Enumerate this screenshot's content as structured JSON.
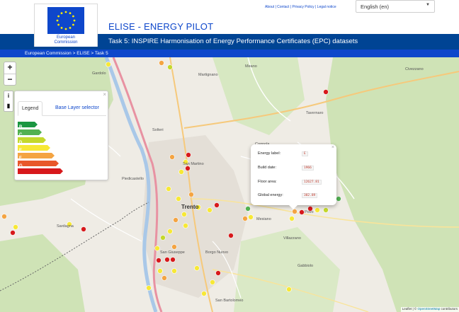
{
  "header": {
    "logo_text_line1": "European",
    "logo_text_line2": "Commission",
    "app_title": "ELISE - ENERGY PILOT",
    "links": [
      "About",
      "Contact",
      "Privacy Policy",
      "Legal notice"
    ],
    "language": "English (en)"
  },
  "subheader": {
    "task_title": "Task 5: INSPIRE Harmonisation of Energy Performance Certificates (EPC) datasets",
    "breadcrumb": [
      "European Commission",
      "ELISE",
      "Task 5"
    ]
  },
  "map": {
    "places": [
      {
        "name": "Trento",
        "big": true
      },
      {
        "name": "Martignano"
      },
      {
        "name": "Civezzano"
      },
      {
        "name": "Meano"
      },
      {
        "name": "Gardolo"
      },
      {
        "name": "Cognola"
      },
      {
        "name": "Piedicastello"
      },
      {
        "name": "San Martino"
      },
      {
        "name": "San Giuseppe"
      },
      {
        "name": "Borgo Nuovo"
      },
      {
        "name": "Sardagna"
      },
      {
        "name": "Povo"
      },
      {
        "name": "Villazzano"
      },
      {
        "name": "San Bartolomeo"
      },
      {
        "name": "Solteri"
      },
      {
        "name": "Tavernaro"
      },
      {
        "name": "Gabbiolo"
      },
      {
        "name": "Mesiano"
      }
    ],
    "zoom_in": "+",
    "zoom_out": "−",
    "tool_info": "i",
    "tool_book": "▮",
    "attribution_text": "Leaflet | © ",
    "attribution_link": "OpenStreetMap",
    "attribution_suffix": " contributors"
  },
  "legend": {
    "tabs": [
      "Legend",
      "Base Layer selector"
    ],
    "classes": [
      {
        "label": "A",
        "color": "#1a9641"
      },
      {
        "label": "B",
        "color": "#52b151"
      },
      {
        "label": "C",
        "color": "#c4d82c"
      },
      {
        "label": "D",
        "color": "#f7e836"
      },
      {
        "label": "E",
        "color": "#f4a442"
      },
      {
        "label": "F",
        "color": "#e8572a"
      },
      {
        "label": "G",
        "color": "#d7191c"
      }
    ]
  },
  "popup": {
    "rows": [
      {
        "label": "Energy label:",
        "value": "E"
      },
      {
        "label": "Build date:",
        "value": "1966"
      },
      {
        "label": "Floor area:",
        "value": "12627.81"
      },
      {
        "label": "Global energy:",
        "value": "382.89"
      }
    ]
  },
  "colors": {
    "ec_blue": "#004494",
    "ec_bright_blue": "#0e47cb"
  }
}
